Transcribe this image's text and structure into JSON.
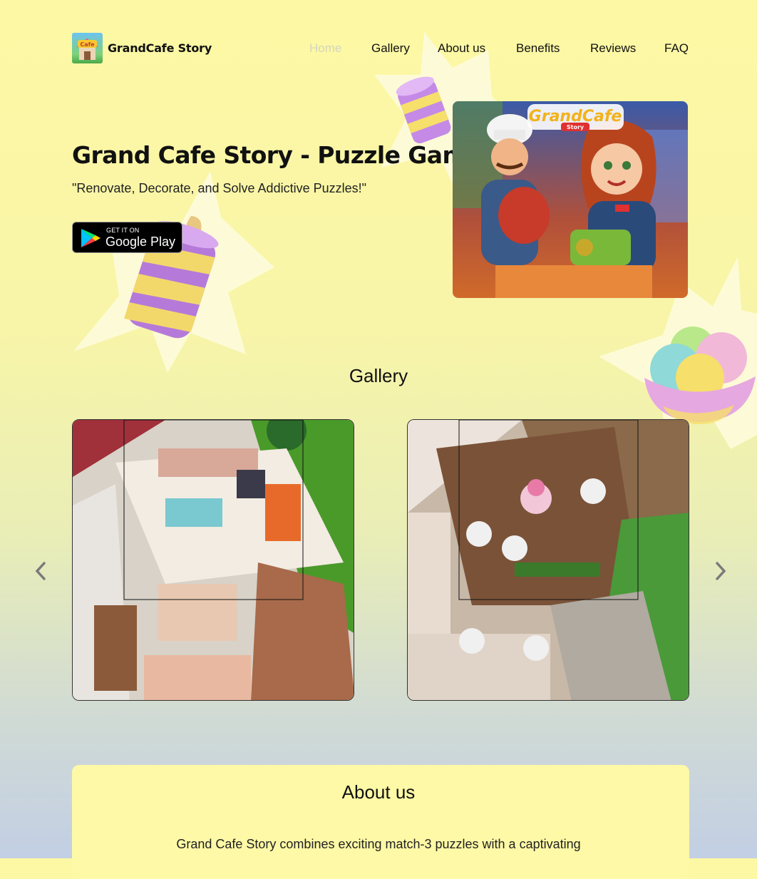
{
  "header": {
    "brand": "GrandCafe Story",
    "logo_icon": "grandcafe-logo-icon",
    "nav": [
      {
        "label": "Home",
        "active": true
      },
      {
        "label": "Gallery",
        "active": false
      },
      {
        "label": "About us",
        "active": false
      },
      {
        "label": "Benefits",
        "active": false
      },
      {
        "label": "Reviews",
        "active": false
      },
      {
        "label": "FAQ",
        "active": false
      }
    ]
  },
  "hero": {
    "title": "Grand Cafe Story - Puzzle Game",
    "subtitle": "\"Renovate, Decorate, and Solve Addictive Puzzles!\"",
    "store_badge": {
      "small": "GET IT ON",
      "big": "Google Play",
      "icon": "google-play-icon"
    },
    "art_logo": {
      "line1": "GrandCafe",
      "line2": "Story"
    }
  },
  "gallery": {
    "title": "Gallery",
    "prev_icon": "chevron-left-icon",
    "next_icon": "chevron-right-icon",
    "items": [
      {
        "icon": "kitchen-scene-image"
      },
      {
        "icon": "cafe-terrace-scene-image"
      }
    ]
  },
  "about": {
    "title": "About us",
    "text": "Grand Cafe Story combines exciting match-3 puzzles with a captivating"
  },
  "colors": {
    "bg_top": "#fdf8a4",
    "bg_bottom": "#c2cfe4",
    "card": "#fef9a6",
    "active_nav": "#d5d5c0"
  }
}
